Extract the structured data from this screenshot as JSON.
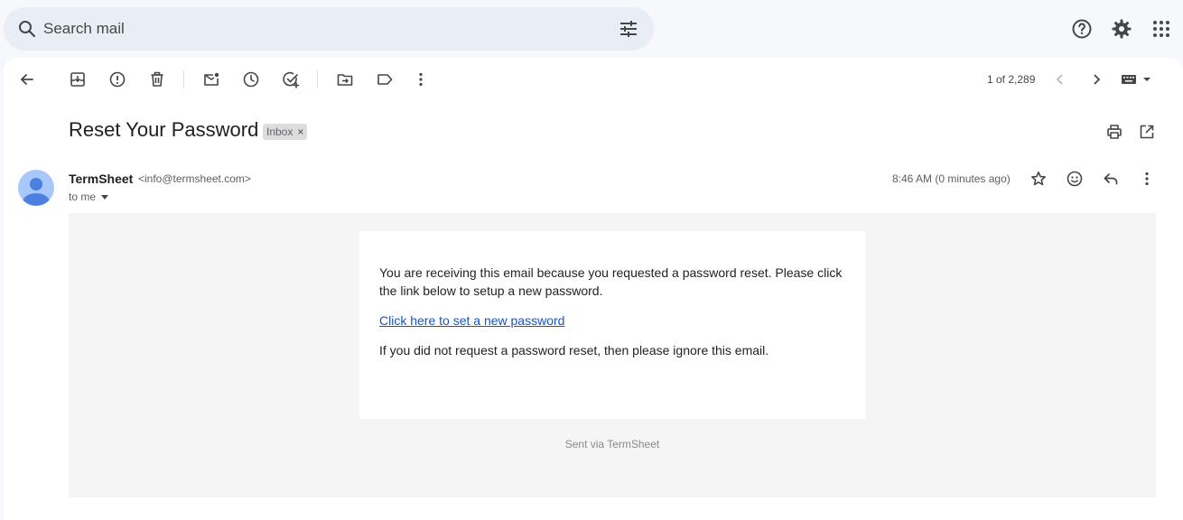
{
  "search": {
    "placeholder": "Search mail"
  },
  "toolbar": {
    "back": "back-icon",
    "pager_text": "1 of 2,289"
  },
  "message": {
    "subject": "Reset Your Password",
    "label": "Inbox",
    "label_remove": "×",
    "sender_name": "TermSheet",
    "sender_email": "<info@termsheet.com>",
    "recipient": "to me",
    "timestamp": "8:46 AM (0 minutes ago)"
  },
  "body": {
    "paragraph1": "You are receiving this email because you requested a password reset. Please click the link below to setup a new password.",
    "link_text": "Click here to set a new password",
    "paragraph2": "If you did not request a password reset, then please ignore this email.",
    "footer": "Sent via TermSheet"
  },
  "colors": {
    "background": "#f6f8fc",
    "search_bg": "#e9eef6",
    "link": "#1155cc",
    "avatar": "#a8c7fa",
    "avatar_figure": "#4b7fe0"
  }
}
